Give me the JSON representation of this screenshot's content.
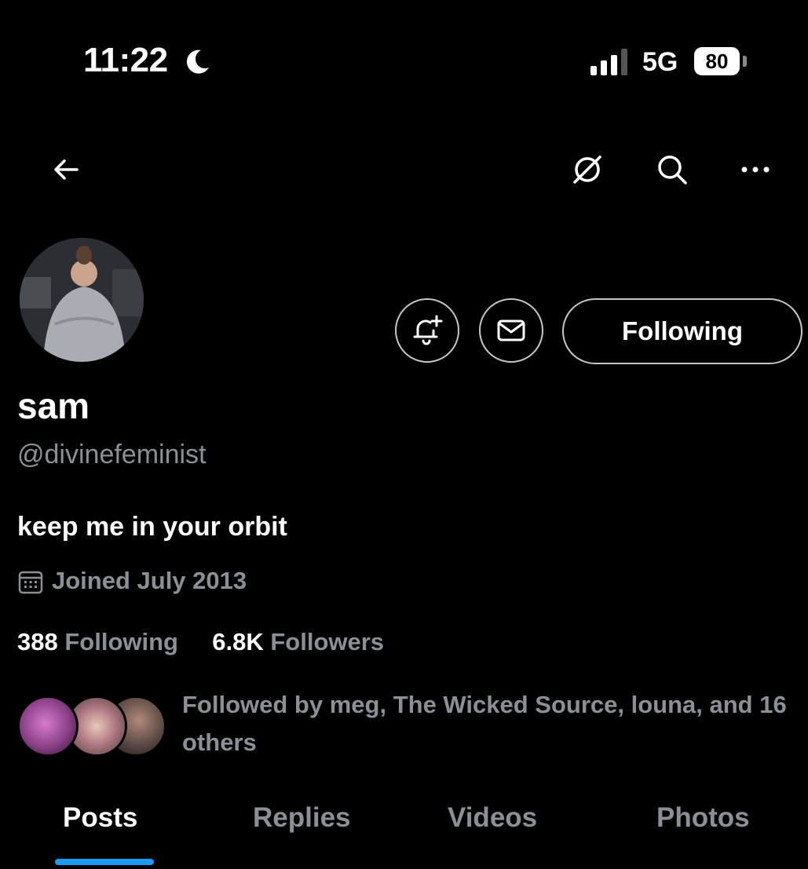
{
  "status_bar": {
    "time": "11:22",
    "network": "5G",
    "battery": "80",
    "icons": [
      "moon-icon",
      "signal-icon"
    ]
  },
  "nav": {
    "icons": [
      "back-arrow-icon",
      "grok-icon",
      "search-icon",
      "more-icon"
    ]
  },
  "profile": {
    "display_name": "sam",
    "handle": "@divinefeminist",
    "bio": "keep me in your orbit",
    "joined": "Joined July 2013",
    "following_count": "388",
    "following_label": "Following",
    "followers_count": "6.8K",
    "followers_label": "Followers"
  },
  "actions": {
    "following_button": "Following",
    "icons": [
      "notification-plus-icon",
      "mail-icon"
    ]
  },
  "followed_by": {
    "text": "Followed by meg, The Wicked Source, louna, and 16 others"
  },
  "tabs": [
    {
      "label": "Posts",
      "active": true
    },
    {
      "label": "Replies",
      "active": false
    },
    {
      "label": "Videos",
      "active": false
    },
    {
      "label": "Photos",
      "active": false
    }
  ],
  "colors": {
    "background": "#000000",
    "text_primary": "#ffffff",
    "text_secondary": "#8b9097",
    "accent": "#1d9bf0",
    "button_border": "#c4c7ca"
  }
}
